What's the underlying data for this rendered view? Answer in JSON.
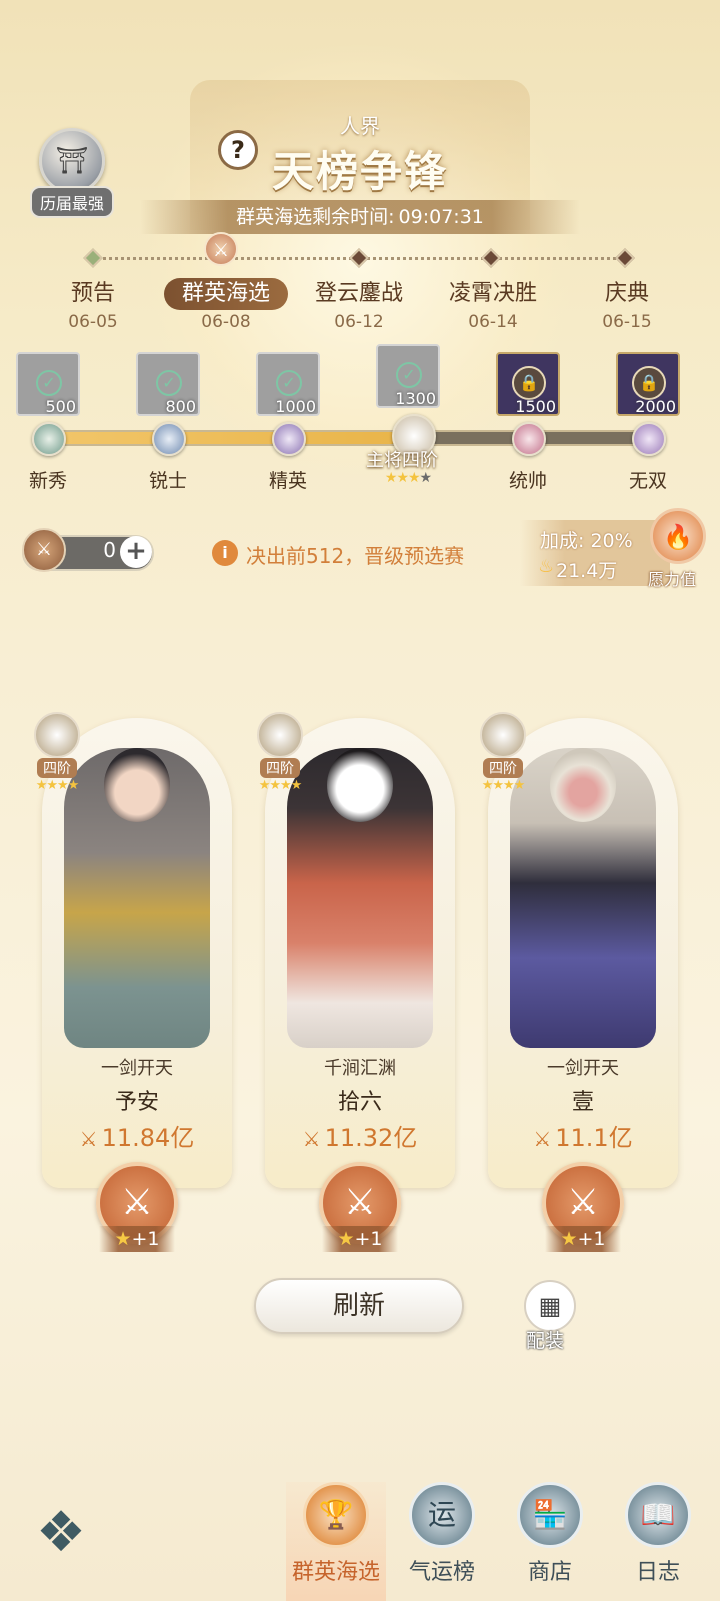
{
  "header": {
    "hall_of_fame_label": "历届最强",
    "help_label": "?",
    "realm": "人界",
    "title": "天榜争锋",
    "countdown_label": "群英海选剩余时间:",
    "countdown_value": "09:07:31"
  },
  "stages": [
    {
      "name": "预告",
      "date": "06-05",
      "active": false
    },
    {
      "name": "群英海选",
      "date": "06-08",
      "active": true
    },
    {
      "name": "登云鏖战",
      "date": "06-12",
      "active": false
    },
    {
      "name": "凌霄决胜",
      "date": "06-14",
      "active": false
    },
    {
      "name": "庆典",
      "date": "06-15",
      "active": false
    }
  ],
  "rewards": [
    {
      "threshold": "500",
      "state": "claimed"
    },
    {
      "threshold": "800",
      "state": "claimed"
    },
    {
      "threshold": "1000",
      "state": "claimed"
    },
    {
      "threshold": "1300",
      "state": "claimed"
    },
    {
      "threshold": "1500",
      "state": "locked"
    },
    {
      "threshold": "2000",
      "state": "locked"
    }
  ],
  "ranks": [
    "新秀",
    "锐士",
    "精英",
    "主将四阶",
    "统帅",
    "无双"
  ],
  "current_rank": {
    "name": "主将四阶",
    "stars": "★★★",
    "empty_stars": "★",
    "progress_fraction": 0.57
  },
  "info_bar": {
    "ticket_count": "0",
    "plus": "+",
    "notice_icon": "i",
    "notice": "决出前512，晋级预选赛",
    "bonus": "加成: 20%",
    "power_value": "21.4万",
    "wish_label": "愿力值"
  },
  "opponents": [
    {
      "tier": "四阶",
      "stars": "★★★★",
      "sect": "一剑开天",
      "name": "予安",
      "power": "11.84亿",
      "bonus": "+1"
    },
    {
      "tier": "四阶",
      "stars": "★★★★",
      "sect": "千涧汇渊",
      "name": "拾六",
      "power": "11.32亿",
      "bonus": "+1"
    },
    {
      "tier": "四阶",
      "stars": "★★★★",
      "sect": "一剑开天",
      "name": "壹",
      "power": "11.1亿",
      "bonus": "+1"
    }
  ],
  "actions": {
    "refresh": "刷新",
    "equip": "配装"
  },
  "nav": [
    {
      "label": "群英海选",
      "icon": "trophy-icon",
      "active": true
    },
    {
      "label": "气运榜",
      "icon": "fortune-icon",
      "active": false
    },
    {
      "label": "商店",
      "icon": "shop-icon",
      "active": false
    },
    {
      "label": "日志",
      "icon": "log-icon",
      "active": false
    }
  ],
  "colors": {
    "accent": "#d0772f",
    "active_tab": "#c6642c",
    "progress": "#e9b54a"
  }
}
